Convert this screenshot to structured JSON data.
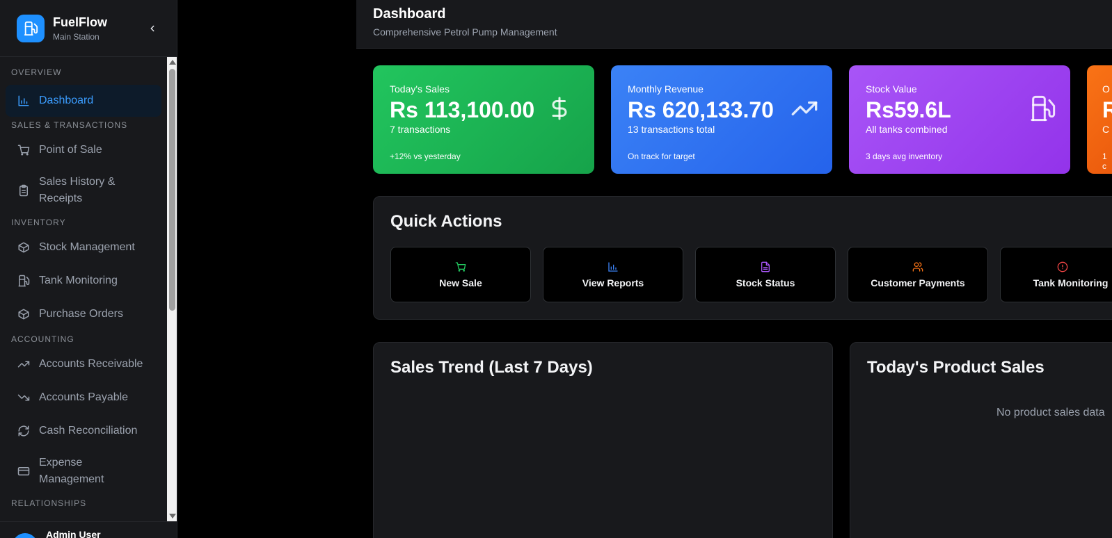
{
  "brand": {
    "name": "FuelFlow",
    "station": "Main Station"
  },
  "sidebar": {
    "sections": {
      "overview": "OVERVIEW",
      "sales": "SALES & TRANSACTIONS",
      "inventory": "INVENTORY",
      "accounting": "ACCOUNTING",
      "relationships": "RELATIONSHIPS"
    },
    "items": {
      "dashboard": "Dashboard",
      "pos": "Point of Sale",
      "sales_history": "Sales History & Receipts",
      "stock": "Stock Management",
      "tank": "Tank Monitoring",
      "purchase": "Purchase Orders",
      "receivable": "Accounts Receivable",
      "payable": "Accounts Payable",
      "cash": "Cash Reconciliation",
      "expense": "Expense Management"
    },
    "active_item": "Dashboard",
    "user_name": "Admin User"
  },
  "header": {
    "title": "Dashboard",
    "subtitle": "Comprehensive Petrol Pump Management"
  },
  "stats": [
    {
      "title": "Today's Sales",
      "value": "Rs 113,100.00",
      "sub": "7 transactions",
      "foot": "+12% vs yesterday",
      "color": "#22c55e",
      "icon": "dollar-icon"
    },
    {
      "title": "Monthly Revenue",
      "value": "Rs 620,133.70",
      "sub": "13 transactions total",
      "foot": "On track for target",
      "color": "#3b82f6",
      "icon": "trending-up-icon"
    },
    {
      "title": "Stock Value",
      "value": "Rs59.6L",
      "sub": "All tanks combined",
      "foot": "3 days avg inventory",
      "color": "#a855f7",
      "icon": "fuel-pump-icon"
    },
    {
      "title": "O",
      "value": "R",
      "sub": "C",
      "foot": "1 c",
      "color": "#f97316",
      "icon": ""
    }
  ],
  "quick_actions": {
    "title": "Quick Actions",
    "items": [
      {
        "label": "New Sale",
        "icon": "cart-icon",
        "color": "#22c55e"
      },
      {
        "label": "View Reports",
        "icon": "bar-chart-icon",
        "color": "#3b82f6"
      },
      {
        "label": "Stock Status",
        "icon": "document-icon",
        "color": "#a855f7"
      },
      {
        "label": "Customer Payments",
        "icon": "users-icon",
        "color": "#f97316"
      },
      {
        "label": "Tank Monitoring",
        "icon": "alert-circle-icon",
        "color": "#ef4444"
      }
    ]
  },
  "sales_trend": {
    "title": "Sales Trend (Last 7 Days)"
  },
  "product_sales": {
    "title": "Today's Product Sales",
    "empty": "No product sales data"
  }
}
